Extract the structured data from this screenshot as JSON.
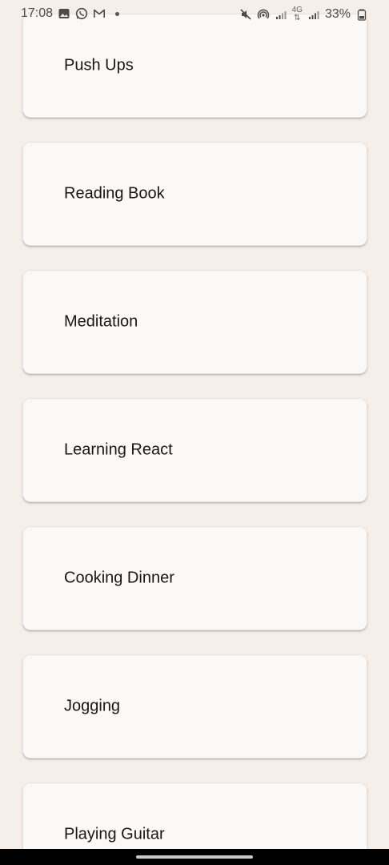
{
  "status_bar": {
    "time": "17:08",
    "battery": "33%",
    "network": "4G",
    "icons": {
      "left": [
        "gallery-icon",
        "whatsapp-icon",
        "gmail-icon",
        "notification-dot"
      ],
      "right": [
        "mute-icon",
        "hotspot-icon",
        "signal-icon",
        "data-arrows-icon",
        "signal-icon-2",
        "battery-icon"
      ]
    }
  },
  "list": {
    "items": [
      {
        "label": "Push Ups"
      },
      {
        "label": "Reading Book"
      },
      {
        "label": "Meditation"
      },
      {
        "label": "Learning React"
      },
      {
        "label": "Cooking Dinner"
      },
      {
        "label": "Jogging"
      },
      {
        "label": "Playing Guitar"
      }
    ]
  },
  "colors": {
    "background": "#f6eee8",
    "card": "#fbf9f8",
    "text": "#171717",
    "nav_bar": "#000000"
  }
}
